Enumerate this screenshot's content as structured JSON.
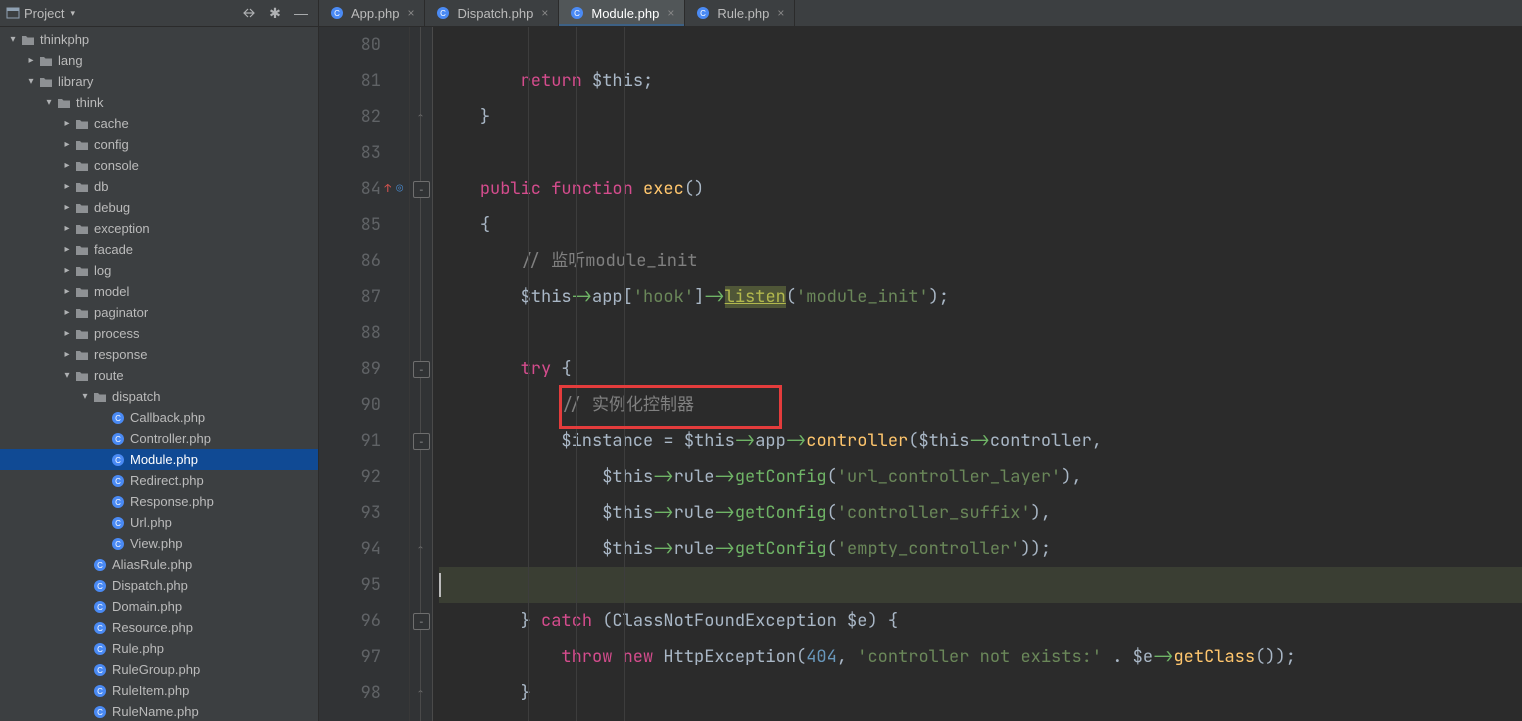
{
  "sidebar": {
    "title": "Project"
  },
  "tree": [
    {
      "depth": 0,
      "expand": "down",
      "icon": "folder",
      "label": "thinkphp"
    },
    {
      "depth": 1,
      "expand": "right",
      "icon": "folder",
      "label": "lang"
    },
    {
      "depth": 1,
      "expand": "down",
      "icon": "folder",
      "label": "library"
    },
    {
      "depth": 2,
      "expand": "down",
      "icon": "folder",
      "label": "think"
    },
    {
      "depth": 3,
      "expand": "right",
      "icon": "folder",
      "label": "cache"
    },
    {
      "depth": 3,
      "expand": "right",
      "icon": "folder",
      "label": "config"
    },
    {
      "depth": 3,
      "expand": "right",
      "icon": "folder",
      "label": "console"
    },
    {
      "depth": 3,
      "expand": "right",
      "icon": "folder",
      "label": "db"
    },
    {
      "depth": 3,
      "expand": "right",
      "icon": "folder",
      "label": "debug"
    },
    {
      "depth": 3,
      "expand": "right",
      "icon": "folder",
      "label": "exception"
    },
    {
      "depth": 3,
      "expand": "right",
      "icon": "folder",
      "label": "facade"
    },
    {
      "depth": 3,
      "expand": "right",
      "icon": "folder",
      "label": "log"
    },
    {
      "depth": 3,
      "expand": "right",
      "icon": "folder",
      "label": "model"
    },
    {
      "depth": 3,
      "expand": "right",
      "icon": "folder",
      "label": "paginator"
    },
    {
      "depth": 3,
      "expand": "right",
      "icon": "folder",
      "label": "process"
    },
    {
      "depth": 3,
      "expand": "right",
      "icon": "folder",
      "label": "response"
    },
    {
      "depth": 3,
      "expand": "down",
      "icon": "folder",
      "label": "route"
    },
    {
      "depth": 4,
      "expand": "down",
      "icon": "folder",
      "label": "dispatch"
    },
    {
      "depth": 5,
      "expand": "blank",
      "icon": "php",
      "label": "Callback.php"
    },
    {
      "depth": 5,
      "expand": "blank",
      "icon": "php",
      "label": "Controller.php"
    },
    {
      "depth": 5,
      "expand": "blank",
      "icon": "php",
      "label": "Module.php",
      "selected": true
    },
    {
      "depth": 5,
      "expand": "blank",
      "icon": "php",
      "label": "Redirect.php"
    },
    {
      "depth": 5,
      "expand": "blank",
      "icon": "php",
      "label": "Response.php"
    },
    {
      "depth": 5,
      "expand": "blank",
      "icon": "php",
      "label": "Url.php"
    },
    {
      "depth": 5,
      "expand": "blank",
      "icon": "php",
      "label": "View.php"
    },
    {
      "depth": 4,
      "expand": "blank",
      "icon": "php",
      "label": "AliasRule.php"
    },
    {
      "depth": 4,
      "expand": "blank",
      "icon": "php",
      "label": "Dispatch.php"
    },
    {
      "depth": 4,
      "expand": "blank",
      "icon": "php",
      "label": "Domain.php"
    },
    {
      "depth": 4,
      "expand": "blank",
      "icon": "php",
      "label": "Resource.php"
    },
    {
      "depth": 4,
      "expand": "blank",
      "icon": "php",
      "label": "Rule.php"
    },
    {
      "depth": 4,
      "expand": "blank",
      "icon": "php",
      "label": "RuleGroup.php"
    },
    {
      "depth": 4,
      "expand": "blank",
      "icon": "php",
      "label": "RuleItem.php"
    },
    {
      "depth": 4,
      "expand": "blank",
      "icon": "php",
      "label": "RuleName.php"
    }
  ],
  "tabs": [
    {
      "label": "App.php",
      "active": false
    },
    {
      "label": "Dispatch.php",
      "active": false
    },
    {
      "label": "Module.php",
      "active": true
    },
    {
      "label": "Rule.php",
      "active": false
    }
  ],
  "code": {
    "lines": [
      {
        "n": 80,
        "html": ""
      },
      {
        "n": 81,
        "html": "        <span class='tk-kw'>return</span> <span class='tk-var'>$this</span><span class='tk-punct'>;</span>"
      },
      {
        "n": 82,
        "html": "    <span class='tk-punct'>}</span>",
        "fold": "end"
      },
      {
        "n": 83,
        "html": ""
      },
      {
        "n": 84,
        "html": "    <span class='tk-kw'>public</span> <span class='tk-kw'>function</span> <span class='tk-exec'>exec</span><span class='tk-punct'>()</span>",
        "marks": [
          "circle-o",
          "arrow-up"
        ],
        "fold": "start"
      },
      {
        "n": 85,
        "html": "    <span class='tk-punct'>{</span>"
      },
      {
        "n": 86,
        "html": "        <span class='tk-comment'>// 监听module_init</span>"
      },
      {
        "n": 87,
        "html": "        <span class='tk-var'>$this</span><span class='tk-arrow'>-&gt;</span><span class='tk-var'>app</span><span class='tk-punct'>[</span><span class='tk-str'>'hook'</span><span class='tk-punct'>]</span><span class='tk-arrow'>-&gt;</span><span class='tk-listen'>listen</span><span class='tk-punct'>(</span><span class='tk-str'>'module_init'</span><span class='tk-punct'>);</span>"
      },
      {
        "n": 88,
        "html": ""
      },
      {
        "n": 89,
        "html": "        <span class='tk-kw'>try</span> <span class='tk-punct'>{</span>",
        "fold": "start"
      },
      {
        "n": 90,
        "html": "            <span class='tk-comment'>// 实例化控制器</span>",
        "redbox": true
      },
      {
        "n": 91,
        "html": "            <span class='tk-var'>$instance</span> <span class='tk-punct'>=</span> <span class='tk-var'>$this</span><span class='tk-arrow'>-&gt;</span><span class='tk-var'>app</span><span class='tk-arrow'>-&gt;</span><span class='tk-method'>controller</span><span class='tk-punct'>(</span><span class='tk-var'>$this</span><span class='tk-arrow'>-&gt;</span><span class='tk-var'>controller</span><span class='tk-punct'>,</span>",
        "fold": "start"
      },
      {
        "n": 92,
        "html": "                <span class='tk-var'>$this</span><span class='tk-arrow'>-&gt;</span><span class='tk-var'>rule</span><span class='tk-arrow'>-&gt;</span><span class='tk-method-g'>getConfig</span><span class='tk-punct'>(</span><span class='tk-str'>'url_controller_layer'</span><span class='tk-punct'>),</span>"
      },
      {
        "n": 93,
        "html": "                <span class='tk-var'>$this</span><span class='tk-arrow'>-&gt;</span><span class='tk-var'>rule</span><span class='tk-arrow'>-&gt;</span><span class='tk-method-g'>getConfig</span><span class='tk-punct'>(</span><span class='tk-str'>'controller_suffix'</span><span class='tk-punct'>),</span>"
      },
      {
        "n": 94,
        "html": "                <span class='tk-var'>$this</span><span class='tk-arrow'>-&gt;</span><span class='tk-var'>rule</span><span class='tk-arrow'>-&gt;</span><span class='tk-method-g'>getConfig</span><span class='tk-punct'>(</span><span class='tk-str'>'empty_controller'</span><span class='tk-punct'>));</span>",
        "fold": "end"
      },
      {
        "n": 95,
        "html": "",
        "cursor": true
      },
      {
        "n": 96,
        "html": "        <span class='tk-punct'>}</span> <span class='tk-kw'>catch</span> <span class='tk-punct'>(</span><span class='tk-class'>ClassNotFoundException</span> <span class='tk-var'>$e</span><span class='tk-punct'>) {</span>",
        "fold": "mix"
      },
      {
        "n": 97,
        "html": "            <span class='tk-kw'>throw</span> <span class='tk-kw'>new</span> <span class='tk-class'>HttpException</span><span class='tk-punct'>(</span><span class='tk-num'>404</span><span class='tk-punct'>,</span> <span class='tk-str'>'controller not exists:'</span> <span class='tk-punct'>.</span> <span class='tk-var'>$e</span><span class='tk-arrow'>-&gt;</span><span class='tk-method'>getClass</span><span class='tk-punct'>());</span>"
      },
      {
        "n": 98,
        "html": "        <span class='tk-punct'>}</span>",
        "fold": "end"
      }
    ]
  }
}
